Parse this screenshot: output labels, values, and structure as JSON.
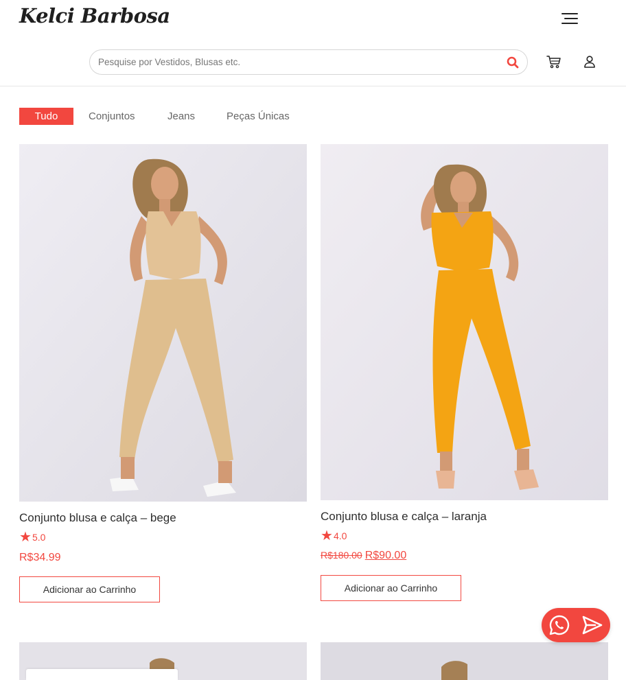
{
  "brand": {
    "logo_text": "Kelci Barbosa",
    "accent_color": "#f2473f"
  },
  "header": {
    "menu_icon": "hamburger-menu-icon",
    "search": {
      "placeholder": "Pesquise por Vestidos, Blusas etc.",
      "value": "",
      "icon": "search-icon"
    },
    "cart_icon": "cart-icon",
    "user_icon": "user-icon"
  },
  "tabs": [
    {
      "label": "Tudo",
      "active": true
    },
    {
      "label": "Conjuntos",
      "active": false
    },
    {
      "label": "Jeans",
      "active": false
    },
    {
      "label": "Peças Únicas",
      "active": false
    }
  ],
  "products": [
    {
      "title": "Conjunto blusa e calça – bege",
      "rating": "5.0",
      "old_price": "",
      "price": "R$34.99",
      "button": "Adicionar ao Carrinho",
      "outfit_color": "#e3c296"
    },
    {
      "title": "Conjunto blusa e calça – laranja",
      "rating": "4.0",
      "old_price": "R$180.00",
      "price": "R$90.00",
      "button": "Adicionar ao Carrinho",
      "outfit_color": "#f4a413"
    }
  ],
  "floating": {
    "whatsapp_icon": "whatsapp-icon",
    "send_icon": "send-icon"
  }
}
